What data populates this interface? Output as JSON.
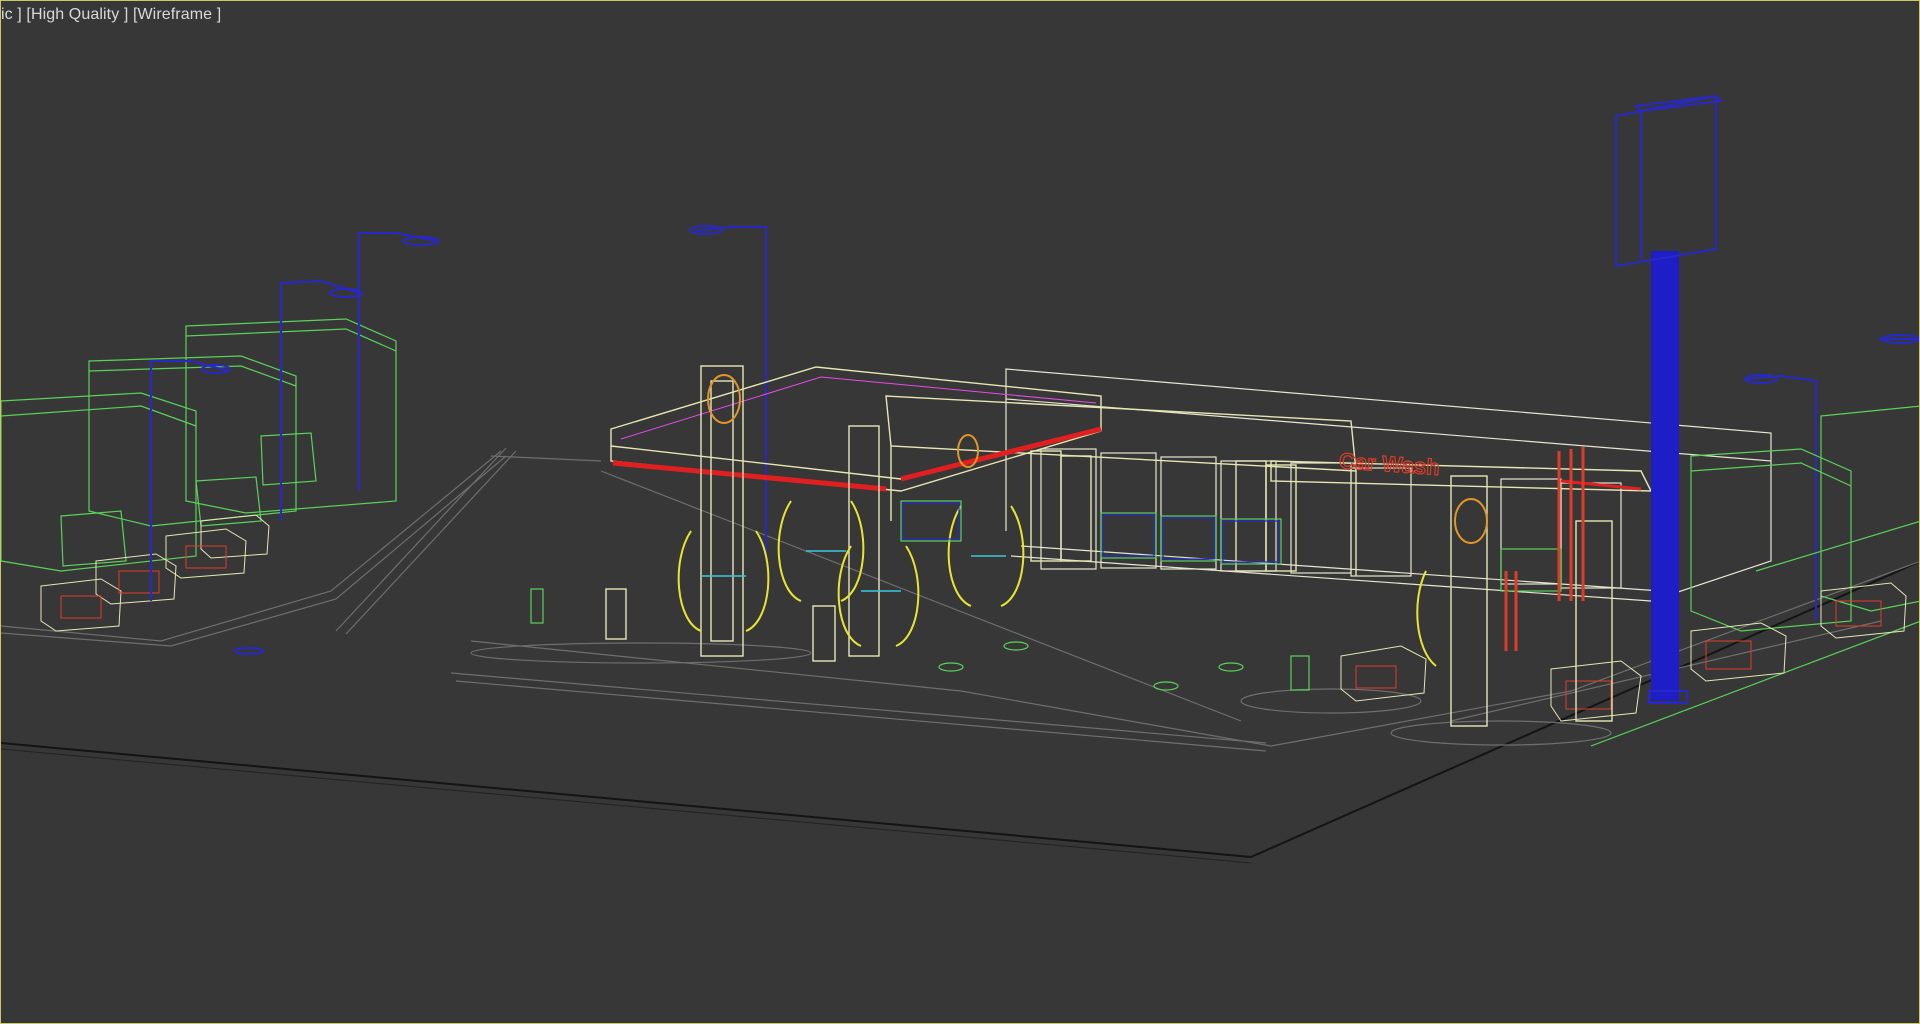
{
  "viewport": {
    "label_parts": [
      "ic ]",
      "[High Quality ]",
      "[Wireframe ]"
    ],
    "border_color": "#c8c864",
    "background": "#373737",
    "render_mode": "wireframe"
  },
  "scene": {
    "sign_text": "Car Wash",
    "colors": {
      "ground": "#1a1a1a",
      "lot_lines": "#6e6e6e",
      "trees_buildings": "#5ad25a",
      "lamp_posts": "#2828c8",
      "pylon": "#1e1ec8",
      "canopy": "#e6e6b4",
      "canopy_red": "#e02020",
      "pumps": "#e6e632",
      "planters": "#e6e6b4",
      "accent_red": "#dc3c28",
      "accent_cyan": "#3cc8dc",
      "signs": "#e09628"
    },
    "icons": [
      "viewport-menu-icon"
    ]
  }
}
